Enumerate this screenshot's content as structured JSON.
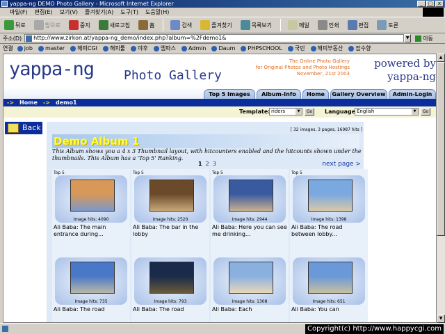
{
  "window": {
    "title": "yappa-ng DEMO Photo Gallery - Microsoft Internet Explorer",
    "min": "_",
    "max": "□",
    "close": "x"
  },
  "menu": [
    "파일(F)",
    "편집(E)",
    "보기(V)",
    "즐겨찾기(A)",
    "도구(T)",
    "도움말(H)"
  ],
  "toolbar": [
    "뒤로",
    "앞으로",
    "중지",
    "새로고침",
    "홈",
    "검색",
    "즐겨찾기",
    "목록보기",
    "메일",
    "인쇄",
    "편집",
    "토론"
  ],
  "address": {
    "label": "주소(D)",
    "url": "http://www.zirkon.at/yappa-ng_demo/index.php?album=%2Fdemo1&",
    "go": "이동"
  },
  "links": {
    "label": "연결",
    "items": [
      "job",
      "master",
      "해피CGI",
      "해피툴",
      "야후",
      "엠파스",
      "Admin",
      "Daum",
      "PHPSCHOOL",
      "국민",
      "해피부동산",
      "잡수향"
    ]
  },
  "site": {
    "brand": "yappa-ng",
    "brand_sub": "Photo Gallery",
    "tagline1": "The Online Photo Gallery",
    "tagline2": "for Original Photos and Photo Hostings",
    "tagline3": "November, 21st 2003",
    "powered1": "powered by",
    "powered2": "yappa-ng"
  },
  "tabs": [
    "Top 5 Images",
    "Album-Info",
    "Home",
    "Gallery Overview",
    "Admin-Login"
  ],
  "breadcrumb": {
    "arrow": "->",
    "home": "Home",
    "current": "demo1"
  },
  "options": {
    "template_label": "Template:",
    "template_value": "riders",
    "language_label": "Language:",
    "language_value": "English",
    "go": "Go"
  },
  "back": "Back",
  "album": {
    "stats": "[ 32 images, 3 pages, 16987 hits ]",
    "title": "Demo Album 1",
    "desc": "This Album shows you a 4 x 3 Thumbnail layout, with hitcounters enabled and the hitcounts shown under the thumbnails. This Album has a 'Top 5' Ranking.",
    "pages": [
      "1",
      "2",
      "3"
    ],
    "next": "next page >"
  },
  "thumbs": [
    {
      "badge": "Top 5",
      "hits": "Image hits: 4090",
      "caption": "Ali Baba: The main entrance during...",
      "c1": "#d89858",
      "c2": "#7a98c8"
    },
    {
      "badge": "Top 5",
      "hits": "Image hits: 2520",
      "caption": "Ali Baba: The bar in the lobby",
      "c1": "#6a4a2a",
      "c2": "#c8a878"
    },
    {
      "badge": "Top 5",
      "hits": "Image hits: 2944",
      "caption": "Ali Baba: Here you can see me drinking...",
      "c1": "#3a5aa0",
      "c2": "#c8b090"
    },
    {
      "badge": "Top 5",
      "hits": "Image hits: 1398",
      "caption": "Ali Baba: The road between lobby...",
      "c1": "#7aa8e0",
      "c2": "#d8c8a8"
    },
    {
      "badge": "",
      "hits": "Image hits: 735",
      "caption": "Ali Baba: The road",
      "c1": "#4a78c8",
      "c2": "#b8b8a8"
    },
    {
      "badge": "",
      "hits": "Image hits: 793",
      "caption": "Ali Baba: The road",
      "c1": "#1a2a4a",
      "c2": "#6a5a3a"
    },
    {
      "badge": "",
      "hits": "Image hits: 1308",
      "caption": "Ali Baba: Each",
      "c1": "#8ab0e0",
      "c2": "#e8d8b8"
    },
    {
      "badge": "",
      "hits": "Image hits: 651",
      "caption": "Ali Baba: You can",
      "c1": "#6a98d8",
      "c2": "#c8c0a0"
    }
  ],
  "status": {
    "copyright": "Copyright(c) http://www.happycgi.com"
  }
}
